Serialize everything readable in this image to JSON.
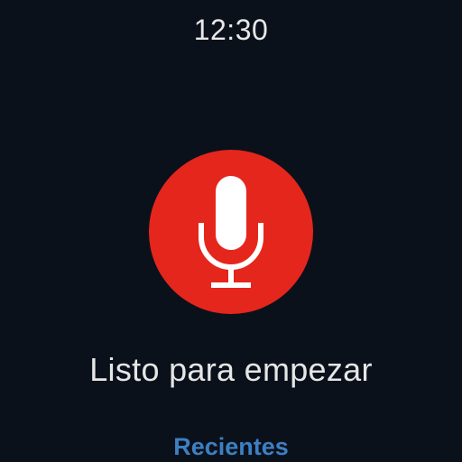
{
  "status_bar": {
    "time": "12:30"
  },
  "voice": {
    "mic_icon": "microphone-icon",
    "prompt": "Listo para empezar",
    "recent_label": "Recientes"
  },
  "colors": {
    "background": "#0b111b",
    "mic_button": "#e5261c",
    "mic_glyph": "#ffffff",
    "link": "#3d7fc2",
    "text": "#e6e6e6"
  }
}
